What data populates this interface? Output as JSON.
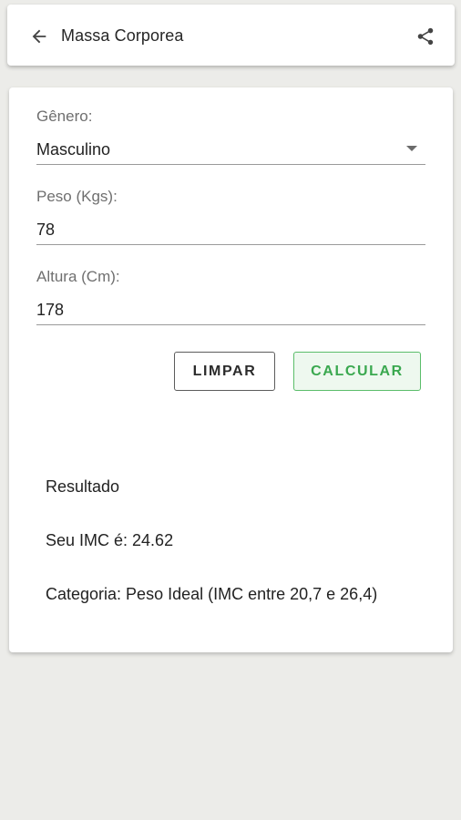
{
  "appbar": {
    "title": "Massa Corporea",
    "back_icon": "arrow-back-icon",
    "share_icon": "share-icon"
  },
  "form": {
    "gender": {
      "label": "Gênero:",
      "value": "Masculino"
    },
    "weight": {
      "label": "Peso (Kgs):",
      "value": "78"
    },
    "height": {
      "label": "Altura (Cm):",
      "value": "178"
    }
  },
  "buttons": {
    "clear_label": "LIMPAR",
    "calculate_label": "CALCULAR"
  },
  "result": {
    "heading": "Resultado",
    "imc": "Seu IMC é: 24.62",
    "category": "Categoria: Peso Ideal (IMC entre 20,7 e 26,4)"
  },
  "colors": {
    "accent": "#3aa84f",
    "background": "#ecece9"
  }
}
